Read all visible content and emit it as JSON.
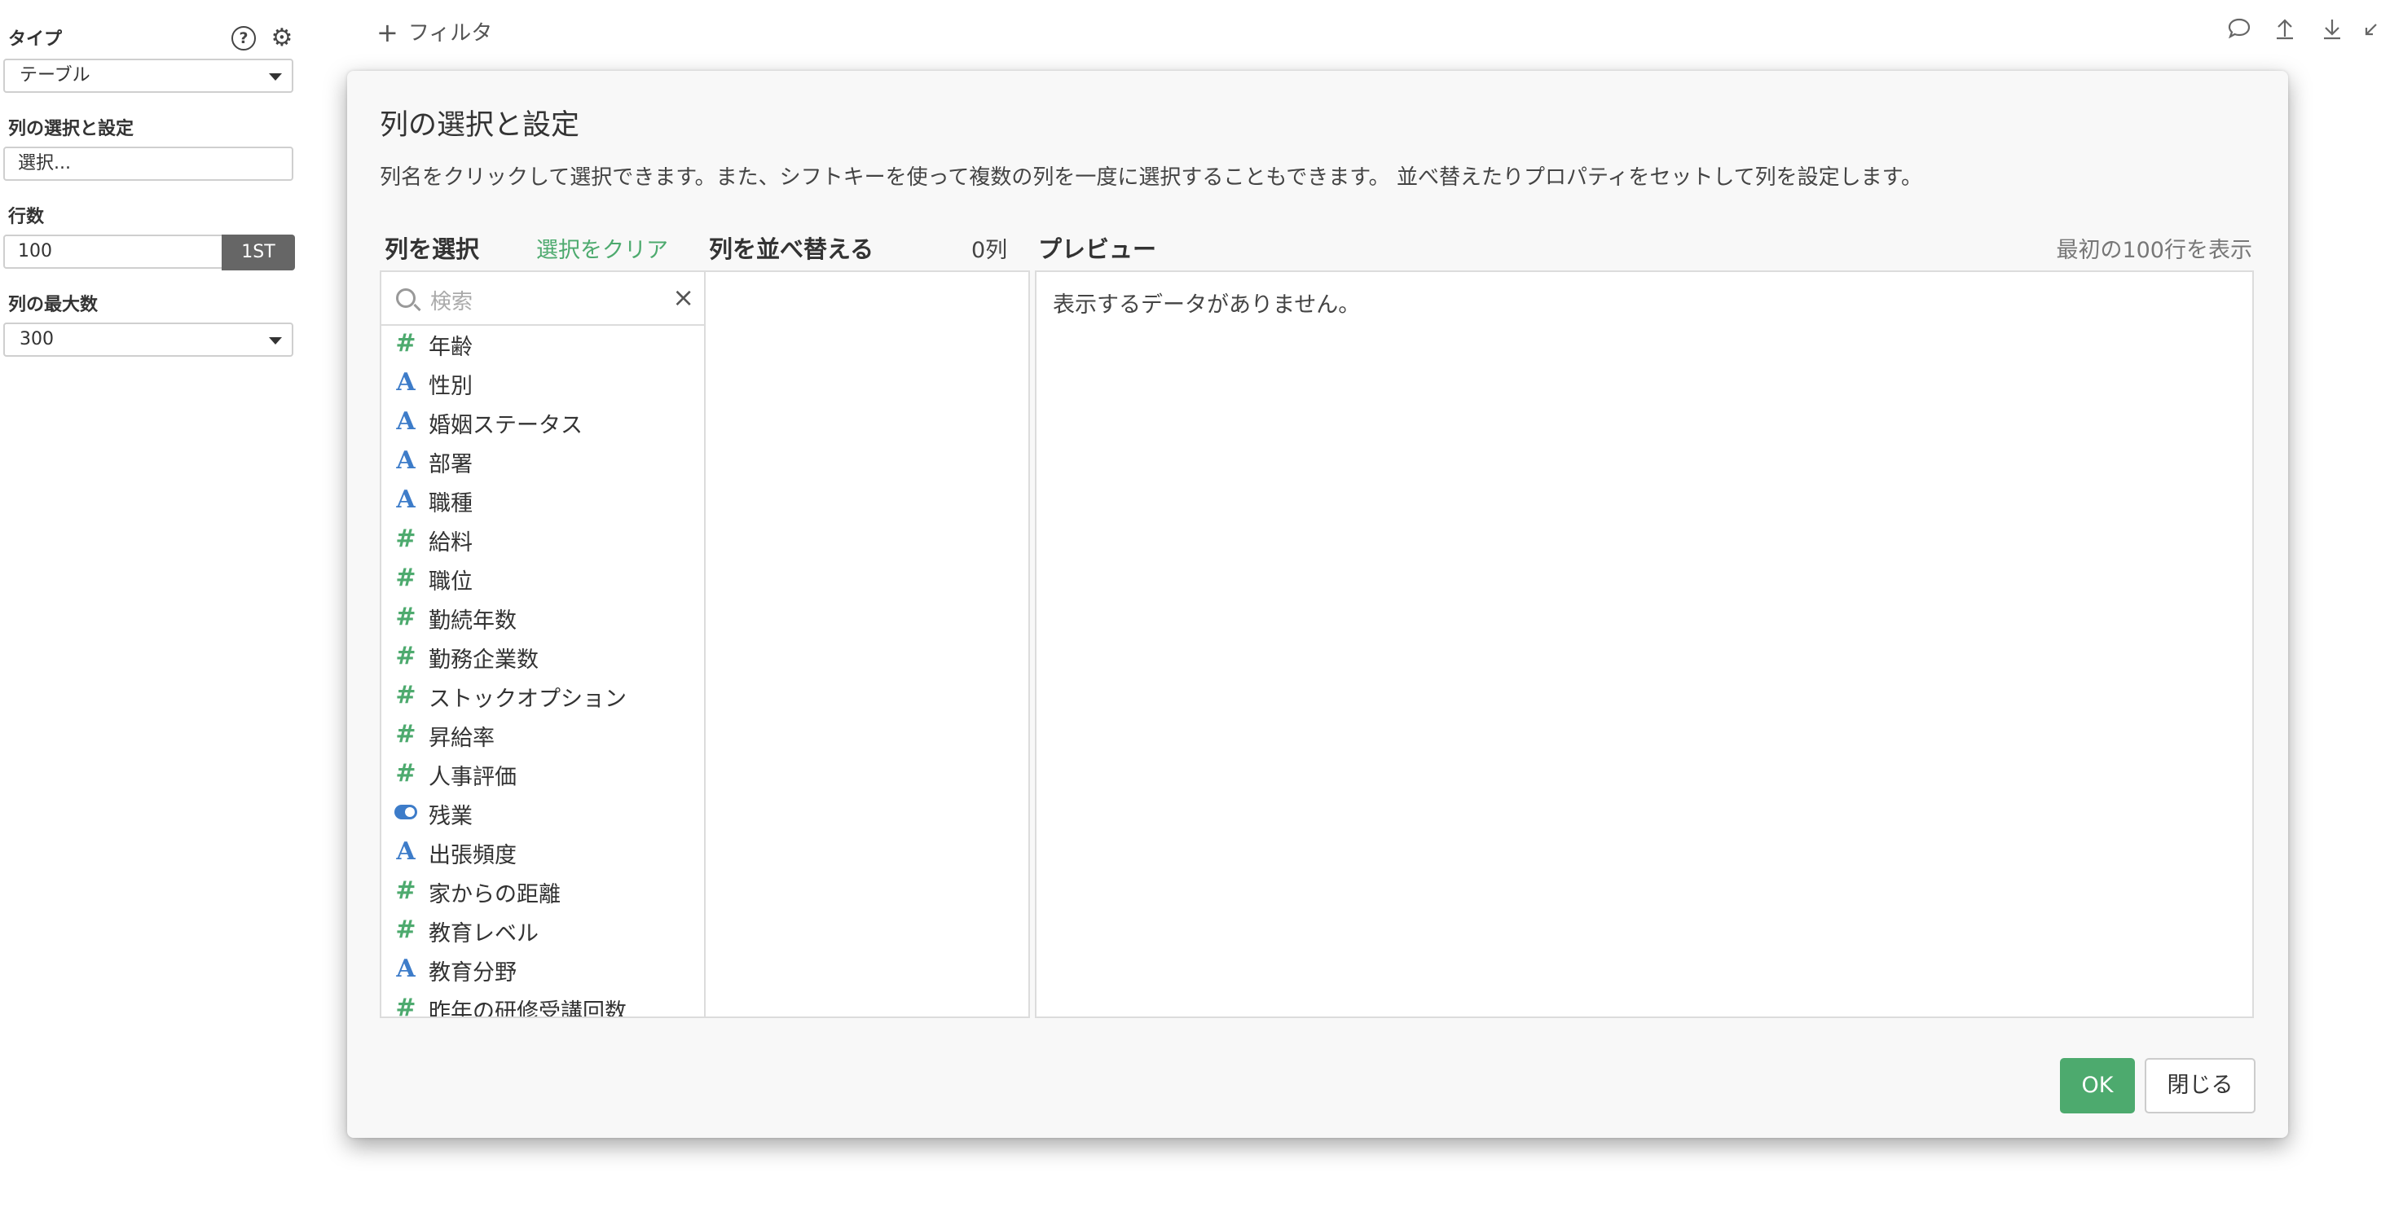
{
  "sidebar": {
    "type_label": "タイプ",
    "type_value": "テーブル",
    "columns_label": "列の選択と設定",
    "columns_value": "選択...",
    "rows_label": "行数",
    "rows_value": "100",
    "rows_button": "1ST",
    "maxcols_label": "列の最大数",
    "maxcols_value": "300"
  },
  "topbar": {
    "filter_label": "フィルタ",
    "icons": [
      "comment-icon",
      "upload-icon",
      "download-icon",
      "collapse-icon"
    ]
  },
  "dialog": {
    "title": "列の選択と設定",
    "description": "列名をクリックして選択できます。また、シフトキーを使って複数の列を一度に選択することもできます。 並べ替えたりプロパティをセットして列を設定します。",
    "select_header": "列を選択",
    "clear_link": "選択をクリア",
    "reorder_header": "列を並べ替える",
    "column_count": "0列",
    "preview_header": "プレビュー",
    "preview_note": "最初の100行を表示",
    "search_placeholder": "検索",
    "empty_message": "表示するデータがありません。",
    "ok_label": "OK",
    "close_label": "閉じる",
    "columns": [
      {
        "name": "年齢",
        "type": "number"
      },
      {
        "name": "性別",
        "type": "string"
      },
      {
        "name": "婚姻ステータス",
        "type": "string"
      },
      {
        "name": "部署",
        "type": "string"
      },
      {
        "name": "職種",
        "type": "string"
      },
      {
        "name": "給料",
        "type": "number"
      },
      {
        "name": "職位",
        "type": "number"
      },
      {
        "name": "勤続年数",
        "type": "number"
      },
      {
        "name": "勤務企業数",
        "type": "number"
      },
      {
        "name": "ストックオプション",
        "type": "number"
      },
      {
        "name": "昇給率",
        "type": "number"
      },
      {
        "name": "人事評価",
        "type": "number"
      },
      {
        "name": "残業",
        "type": "boolean"
      },
      {
        "name": "出張頻度",
        "type": "string"
      },
      {
        "name": "家からの距離",
        "type": "number"
      },
      {
        "name": "教育レベル",
        "type": "number"
      },
      {
        "name": "教育分野",
        "type": "string"
      },
      {
        "name": "昨年の研修受講回数",
        "type": "number"
      }
    ]
  },
  "colors": {
    "accent_green": "#4daa6e",
    "type_blue": "#3d7cc9",
    "dark_button": "#666666"
  }
}
